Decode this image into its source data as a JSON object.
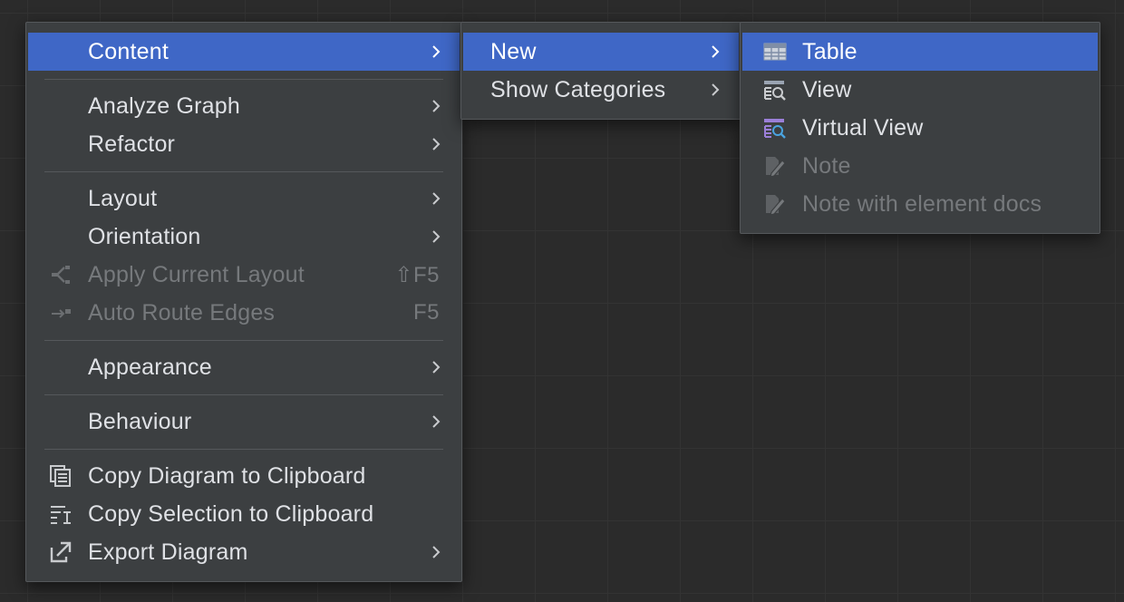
{
  "main_menu": {
    "items": [
      {
        "label": "Content"
      },
      {
        "label": "Analyze Graph"
      },
      {
        "label": "Refactor"
      },
      {
        "label": "Layout"
      },
      {
        "label": "Orientation"
      },
      {
        "label": "Apply Current Layout",
        "shortcut": "⇧F5"
      },
      {
        "label": "Auto Route Edges",
        "shortcut": "F5"
      },
      {
        "label": "Appearance"
      },
      {
        "label": "Behaviour"
      },
      {
        "label": "Copy Diagram to Clipboard"
      },
      {
        "label": "Copy Selection to Clipboard"
      },
      {
        "label": "Export Diagram"
      }
    ]
  },
  "content_submenu": {
    "items": [
      {
        "label": "New"
      },
      {
        "label": "Show Categories"
      }
    ]
  },
  "new_submenu": {
    "items": [
      {
        "label": "Table"
      },
      {
        "label": "View"
      },
      {
        "label": "Virtual View"
      },
      {
        "label": "Note"
      },
      {
        "label": "Note with element docs"
      }
    ]
  },
  "colors": {
    "selection": "#3f67c6",
    "menu_background": "#3c3f41",
    "text": "#dfe1e5",
    "disabled_text": "#76797c",
    "canvas_background": "#2b2b2b",
    "virtual_view_accent": "#9b7fd8"
  }
}
